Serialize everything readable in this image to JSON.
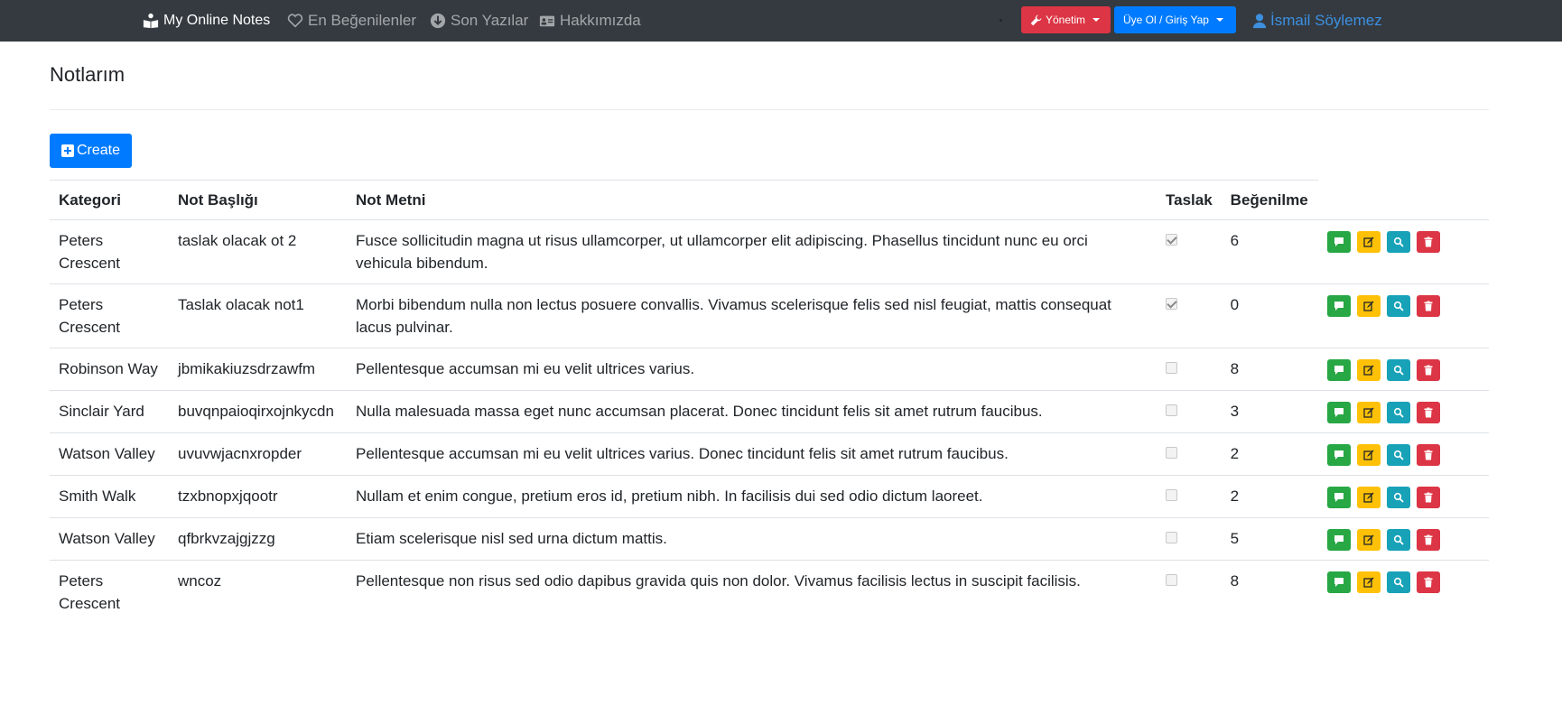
{
  "navbar": {
    "brand": "My Online Notes",
    "brand_icon": "reader-icon",
    "links": [
      {
        "label": "En Beğenilenler",
        "icon": "heart-icon"
      },
      {
        "label": "Son Yazılar",
        "icon": "arrow-circle-down-icon"
      },
      {
        "label": "Hakkımızda",
        "icon": "id-card-icon"
      }
    ],
    "admin_dropdown": {
      "label": "Yönetim",
      "icon": "wrench-icon",
      "color": "#dc3545"
    },
    "auth_dropdown": {
      "label": "Üye Ol / Giriş Yap",
      "color": "#007bff"
    },
    "user": {
      "label": "İsmail Söylemez",
      "icon": "user-icon",
      "color": "#3d8fe0"
    }
  },
  "page": {
    "title": "Notlarım",
    "create_label": "Create"
  },
  "table": {
    "headers": [
      "Kategori",
      "Not Başlığı",
      "Not Metni",
      "Taslak",
      "Beğenilme"
    ],
    "rows": [
      {
        "category": "Peters Crescent",
        "title": "taslak olacak ot 2",
        "text": "Fusce sollicitudin magna ut risus ullamcorper, ut ullamcorper elit adipiscing. Phasellus tincidunt nunc eu orci vehicula bibendum.",
        "draft": true,
        "likes": "6"
      },
      {
        "category": "Peters Crescent",
        "title": "Taslak olacak not1",
        "text": "Morbi bibendum nulla non lectus posuere convallis. Vivamus scelerisque felis sed nisl feugiat, mattis consequat lacus pulvinar.",
        "draft": true,
        "likes": "0"
      },
      {
        "category": "Robinson Way",
        "title": "jbmikakiuzsdrzawfm",
        "text": "Pellentesque accumsan mi eu velit ultrices varius.",
        "draft": false,
        "likes": "8"
      },
      {
        "category": "Sinclair Yard",
        "title": "buvqnpaioqirxojnkycdn",
        "text": "Nulla malesuada massa eget nunc accumsan placerat. Donec tincidunt felis sit amet rutrum faucibus.",
        "draft": false,
        "likes": "3"
      },
      {
        "category": "Watson Valley",
        "title": "uvuvwjacnxropder",
        "text": "Pellentesque accumsan mi eu velit ultrices varius. Donec tincidunt felis sit amet rutrum faucibus.",
        "draft": false,
        "likes": "2"
      },
      {
        "category": "Smith Walk",
        "title": "tzxbnopxjqootr",
        "text": "Nullam et enim congue, pretium eros id, pretium nibh. In facilisis dui sed odio dictum laoreet.",
        "draft": false,
        "likes": "2"
      },
      {
        "category": "Watson Valley",
        "title": "qfbrkvzajgjzzg",
        "text": "Etiam scelerisque nisl sed urna dictum mattis.",
        "draft": false,
        "likes": "5"
      },
      {
        "category": "Peters Crescent",
        "title": "wncoz",
        "text": "Pellentesque non risus sed odio dapibus gravida quis non dolor. Vivamus facilisis lectus in suscipit facilisis.",
        "draft": false,
        "likes": "8"
      }
    ],
    "actions": [
      {
        "name": "comments",
        "icon": "comment-icon",
        "color": "#28a745"
      },
      {
        "name": "edit",
        "icon": "edit-icon",
        "color": "#ffc107"
      },
      {
        "name": "details",
        "icon": "search-icon",
        "color": "#17a2b8"
      },
      {
        "name": "delete",
        "icon": "trash-icon",
        "color": "#dc3545"
      }
    ]
  }
}
